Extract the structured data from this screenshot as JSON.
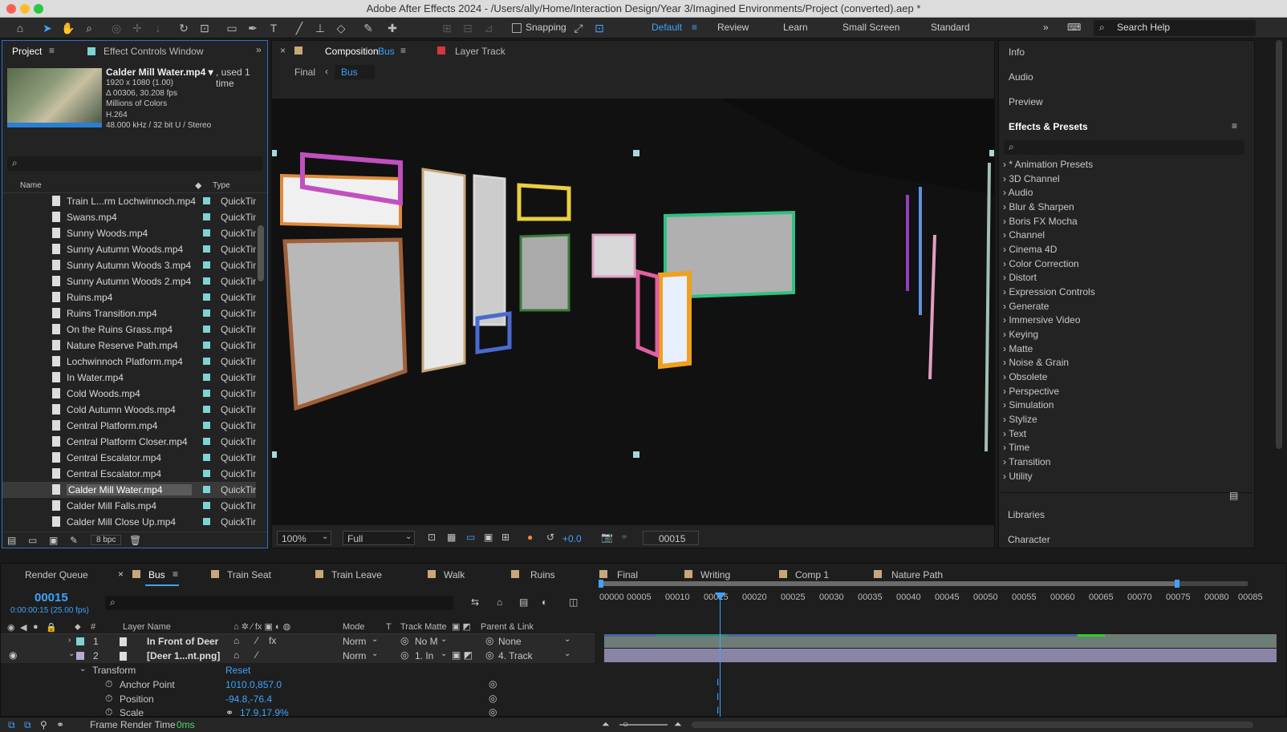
{
  "window": {
    "title": "Adobe After Effects 2024 - /Users/ally/Home/Interaction Design/Year 3/Imagined Environments/Project (converted).aep *"
  },
  "toolbar": {
    "snapping": "Snapping",
    "workspaces": [
      "Default",
      "Review",
      "Learn",
      "Small Screen",
      "Standard"
    ],
    "search": "Search Help"
  },
  "project": {
    "tab": "Project",
    "effect_controls": "Effect Controls Window",
    "selected": {
      "name": "Calder Mill Water.mp4 ▾",
      "used": ", used 1 time",
      "lines": [
        "1920 x 1080 (1.00)",
        "Δ 00306, 30.208 fps",
        "Millions of Colors",
        "H.264",
        "48.000 kHz / 32 bit U / Stereo"
      ]
    },
    "col_name": "Name",
    "col_type": "Type",
    "bpc": "8 bpc",
    "files": [
      "Train L...rm Lochwinnoch.mp4",
      "Swans.mp4",
      "Sunny Woods.mp4",
      "Sunny Autumn Woods.mp4",
      "Sunny Autumn Woods 3.mp4",
      "Sunny Autumn Woods 2.mp4",
      "Ruins.mp4",
      "Ruins Transition.mp4",
      "On the Ruins Grass.mp4",
      "Nature Reserve Path.mp4",
      "Lochwinnoch Platform.mp4",
      "In Water.mp4",
      "Cold Woods.mp4",
      "Cold Autumn Woods.mp4",
      "Central Platform.mp4",
      "Central Platform Closer.mp4",
      "Central Escalator.mp4",
      "Central Escalator.mp4",
      "Calder Mill Water.mp4",
      "Calder Mill Falls.mp4",
      "Calder Mill Close Up.mp4"
    ],
    "file_type": "QuickTim"
  },
  "comp": {
    "tab_prefix": "Composition",
    "tab_name": "Bus",
    "layer_track": "Layer Track",
    "crumb_final": "Final",
    "crumb_bus": "Bus",
    "zoom": "100%",
    "quality": "Full",
    "exposure": "+0.0",
    "timecode": "00015"
  },
  "right": {
    "panels": [
      "Info",
      "Audio",
      "Preview"
    ],
    "effects_title": "Effects & Presets",
    "effects": [
      "* Animation Presets",
      "3D Channel",
      "Audio",
      "Blur & Sharpen",
      "Boris FX Mocha",
      "Channel",
      "Cinema 4D",
      "Color Correction",
      "Distort",
      "Expression Controls",
      "Generate",
      "Immersive Video",
      "Keying",
      "Matte",
      "Noise & Grain",
      "Obsolete",
      "Perspective",
      "Simulation",
      "Stylize",
      "Text",
      "Time",
      "Transition",
      "Utility"
    ],
    "bottom": [
      "Libraries",
      "Character"
    ]
  },
  "timeline": {
    "render_queue": "Render Queue",
    "tabs": [
      "Bus",
      "Train Seat",
      "Train Leave",
      "Walk",
      "Ruins",
      "Final",
      "Writing",
      "Comp 1",
      "Nature Path"
    ],
    "time": "00015",
    "time_sub": "0:00:00:15 (25.00 fps)",
    "cols": {
      "layer": "Layer Name",
      "mode": "Mode",
      "t": "T",
      "track": "Track Matte",
      "parent": "Parent & Link",
      "num": "#"
    },
    "layers": [
      {
        "num": "1",
        "name": "In Front of Deer",
        "mode": "Norm",
        "track": "No M",
        "parent": "None"
      },
      {
        "num": "2",
        "name": "[Deer 1...nt.png]",
        "mode": "Norm",
        "track": "1. In",
        "parent": "4. Track"
      }
    ],
    "transform": "Transform",
    "reset": "Reset",
    "props": [
      {
        "name": "Anchor Point",
        "value": "1010.0,857.0"
      },
      {
        "name": "Position",
        "value": "-94.8,-76.4"
      },
      {
        "name": "Scale",
        "value": "17.9,17.9%"
      }
    ],
    "ticks": [
      "00000",
      "00005",
      "00010",
      "00015",
      "00020",
      "00025",
      "00030",
      "00035",
      "00040",
      "00045",
      "00050",
      "00055",
      "00060",
      "00065",
      "00070",
      "00075",
      "00080",
      "00085"
    ],
    "render_time_label": "Frame Render Time",
    "render_time": "0ms"
  }
}
